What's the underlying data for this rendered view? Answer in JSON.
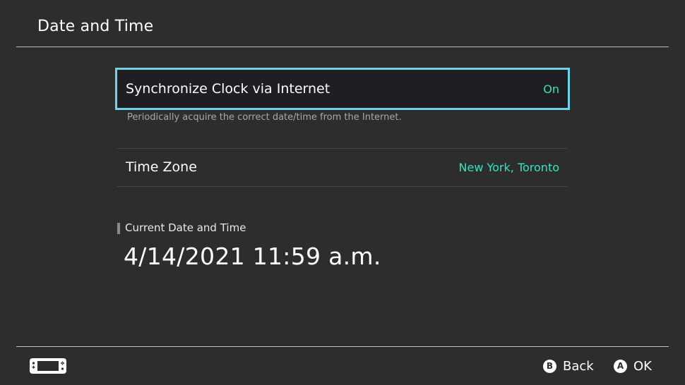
{
  "header": {
    "title": "Date and Time"
  },
  "settings": {
    "sync": {
      "label": "Synchronize Clock via Internet",
      "value": "On",
      "description": "Periodically acquire the correct date/time from the Internet."
    },
    "time_zone": {
      "label": "Time Zone",
      "value": "New York, Toronto"
    }
  },
  "current": {
    "heading": "Current Date and Time",
    "datetime": "4/14/2021 11:59 a.m."
  },
  "footer": {
    "console_icon": "handheld-console-icon",
    "back": {
      "glyph": "B",
      "label": "Back"
    },
    "ok": {
      "glyph": "A",
      "label": "OK"
    }
  },
  "colors": {
    "background": "#2d2d2d",
    "selection_border": "#6fd3e4",
    "value_accent": "#2ee6c0",
    "description": "#a8a8a8"
  }
}
